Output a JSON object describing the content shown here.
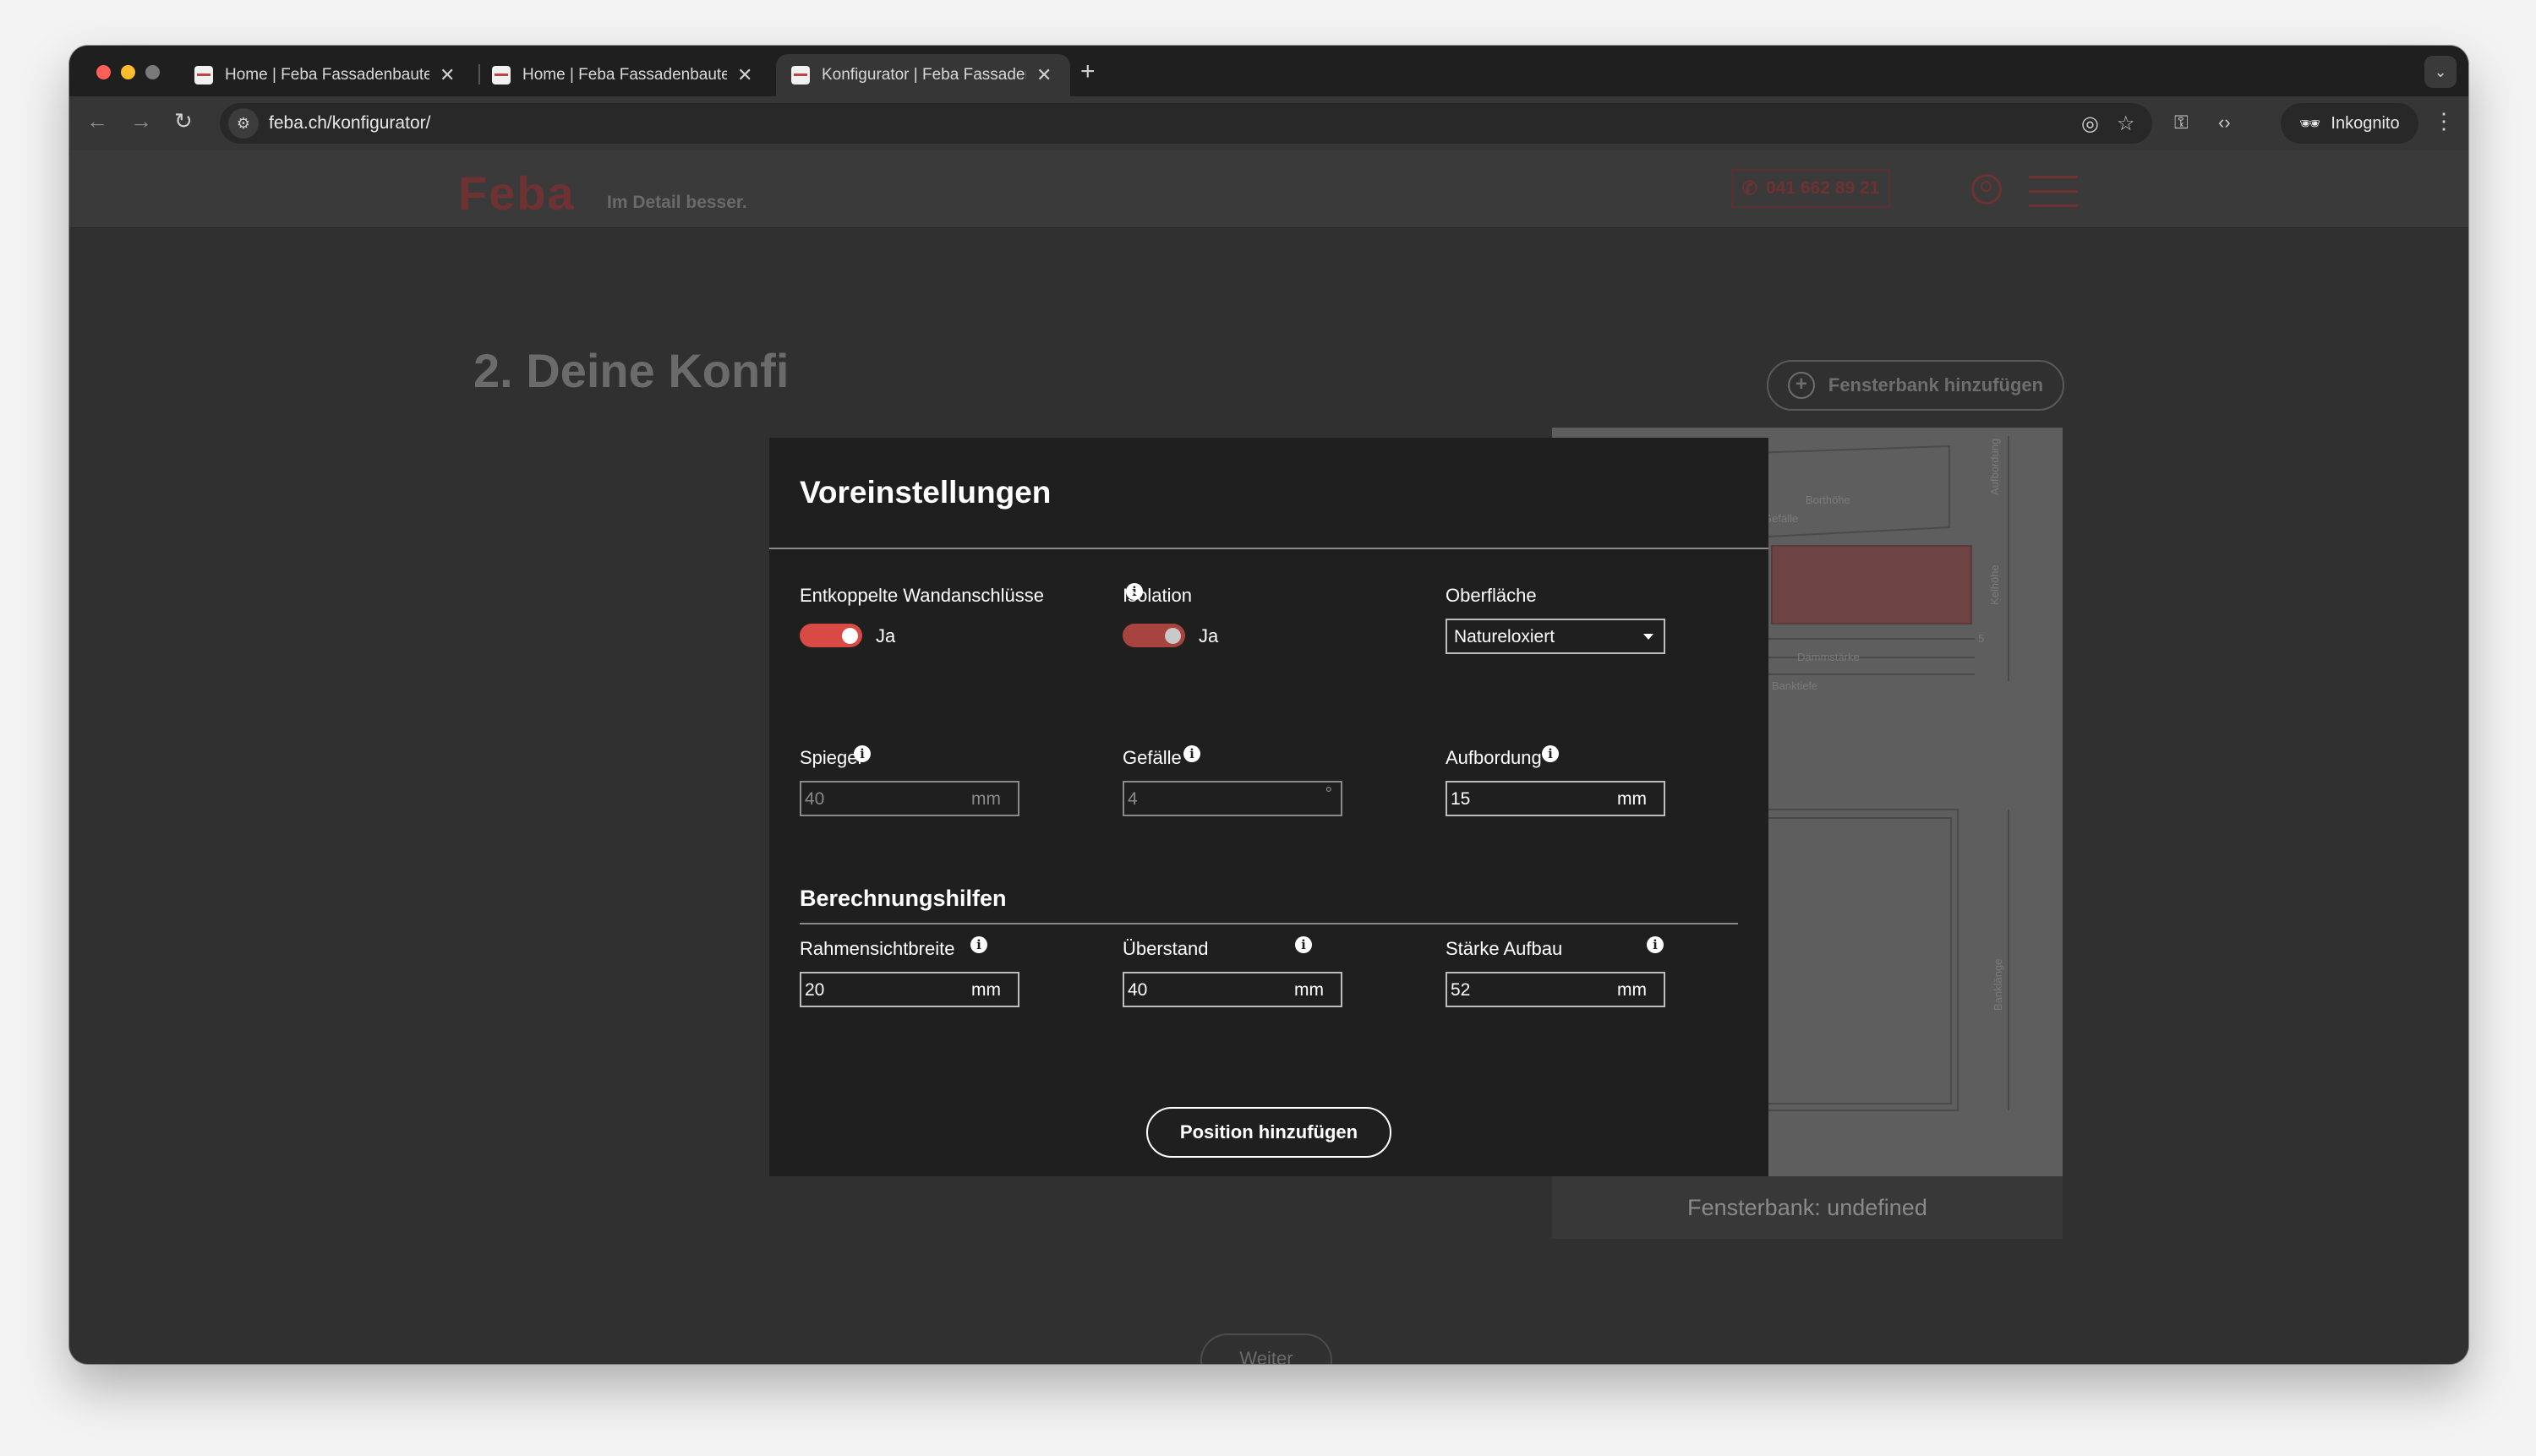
{
  "browser": {
    "tabs": [
      {
        "title": "Home | Feba Fassadenbauteile"
      },
      {
        "title": "Home | Feba Fassadenbauteile"
      },
      {
        "title": "Konfigurator | Feba Fassadenbauteile"
      }
    ],
    "url": "feba.ch/konfigurator/",
    "incognito_label": "Inkognito"
  },
  "site": {
    "logo": "Feba",
    "slogan": "Im Detail besser.",
    "phone": "041 662 89 21"
  },
  "page": {
    "step_title": "2. Deine Konfi",
    "add_sill_button": "Fensterbank hinzufügen",
    "preview_caption": "Fensterbank: undefined",
    "preview_labels": [
      "Aufbordung",
      "Borthöhe",
      "Gefälle",
      "Kelhöhe",
      "Dämmstärke",
      "Banktiefe",
      "Banklänge",
      "5"
    ],
    "next_button": "Weiter"
  },
  "modal": {
    "title": "Voreinstellungen",
    "entkoppelt": {
      "label": "Entkoppelte Wandanschlüsse",
      "value": "Ja",
      "on": true
    },
    "isolation": {
      "label": "Isolation",
      "value": "Ja",
      "on": true
    },
    "oberflaeche": {
      "label": "Oberfläche",
      "value": "Natureloxiert"
    },
    "spiegel": {
      "label": "Spiegel",
      "value": "40",
      "unit": "mm"
    },
    "gefaelle": {
      "label": "Gefälle",
      "value": "4",
      "unit": "°"
    },
    "aufbordung": {
      "label": "Aufbordung",
      "value": "15",
      "unit": "mm"
    },
    "section_title": "Berechnungshilfen",
    "rahmensichtbreite": {
      "label": "Rahmensichtbreite",
      "value": "20",
      "unit": "mm"
    },
    "ueberstand": {
      "label": "Überstand",
      "value": "40",
      "unit": "mm"
    },
    "staerke_aufbau": {
      "label": "Stärke Aufbau",
      "value": "52",
      "unit": "mm"
    },
    "submit": "Position hinzufügen",
    "info_glyph": "i"
  },
  "colors": {
    "accent": "#d94a45",
    "modal_bg": "#1f1f1f",
    "overlay_bg": "#303030"
  }
}
